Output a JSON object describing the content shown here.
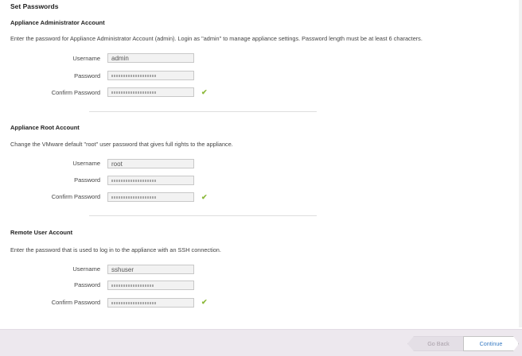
{
  "page": {
    "title": "Set Passwords"
  },
  "sections": [
    {
      "title": "Appliance Administrator Account",
      "description": "Enter the password for Appliance Administrator Account (admin). Login as \"admin\" to manage appliance settings. Password length must be at least 6 characters.",
      "username_label": "Username",
      "username_value": "admin",
      "password_label": "Password",
      "confirm_label": "Confirm Password",
      "confirm_valid": true
    },
    {
      "title": "Appliance Root Account",
      "description": "Change the VMware default \"root\" user password that gives full rights to the appliance.",
      "username_label": "Username",
      "username_value": "root",
      "password_label": "Password",
      "confirm_label": "Confirm Password",
      "confirm_valid": true
    },
    {
      "title": "Remote User Account",
      "description": "Enter the password that is used to log in to the appliance with an SSH connection.",
      "username_label": "Username",
      "username_value": "sshuser",
      "password_label": "Password",
      "confirm_label": "Confirm Password",
      "confirm_valid": true
    }
  ],
  "icons": {
    "valid": "checkmark-icon",
    "check_glyph": "✔"
  },
  "footer": {
    "back_label": "Go Back",
    "continue_label": "Continue"
  },
  "colors": {
    "check": "#8cb83a",
    "continue_text": "#3a7cc4",
    "footer_bg": "#ede8ee"
  }
}
